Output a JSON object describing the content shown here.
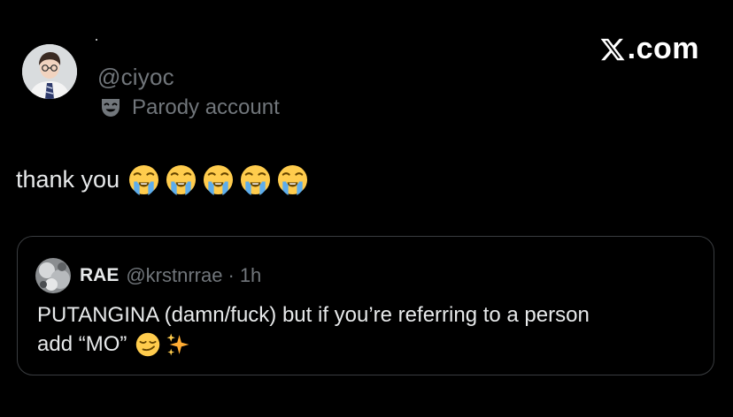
{
  "brand": {
    "label": ".com",
    "logo_icon": "x-logo-icon"
  },
  "author": {
    "handle": "@ciyoc",
    "parody_label": "Parody account",
    "parody_icon": "theater-mask-icon",
    "avatar": "avatar"
  },
  "tweet": {
    "text": "thank you",
    "emojis": [
      "loudly-crying-face-icon",
      "loudly-crying-face-icon",
      "loudly-crying-face-icon",
      "loudly-crying-face-icon",
      "loudly-crying-face-icon"
    ]
  },
  "quote": {
    "name": "RAE",
    "handle": "@krstnrrae",
    "separator": "·",
    "time": "1h",
    "line1": "PUTANGINA (damn/fuck) but if you’re referring to a person",
    "line2": "add “MO”",
    "emojis": [
      "smirking-face-icon",
      "sparkles-icon"
    ]
  },
  "colors": {
    "background": "#000000",
    "primary_text": "#e7e9ea",
    "secondary_text": "#71767b",
    "border": "#3a3d40"
  }
}
